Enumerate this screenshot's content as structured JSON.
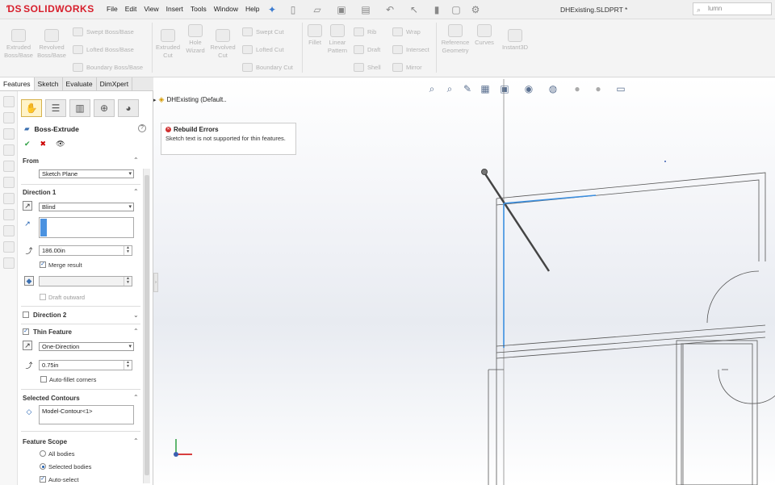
{
  "app": {
    "logo_text": "SOLIDWORKS",
    "doc_title": "DHExisting.SLDPRT *"
  },
  "menu": [
    "File",
    "Edit",
    "View",
    "Insert",
    "Tools",
    "Window",
    "Help"
  ],
  "search": {
    "value": "lumn"
  },
  "ribbon": {
    "extruded_boss": "Extruded Boss/Base",
    "revolved_boss": "Revolved Boss/Base",
    "swept_boss": "Swept Boss/Base",
    "lofted_boss": "Lofted Boss/Base",
    "boundary_boss": "Boundary Boss/Base",
    "extruded_cut": "Extruded Cut",
    "hole_wizard": "Hole Wizard",
    "revolved_cut": "Revolved Cut",
    "swept_cut": "Swept Cut",
    "lofted_cut": "Lofted Cut",
    "boundary_cut": "Boundary Cut",
    "fillet": "Fillet",
    "linear_pattern": "Linear Pattern",
    "rib": "Rib",
    "draft": "Draft",
    "shell": "Shell",
    "wrap": "Wrap",
    "intersect": "Intersect",
    "mirror": "Mirror",
    "reference_geometry": "Reference Geometry",
    "curves": "Curves",
    "instant3d": "Instant3D"
  },
  "tabs": [
    "Features",
    "Sketch",
    "Evaluate",
    "DimXpert"
  ],
  "property_manager": {
    "title": "Boss-Extrude",
    "help": "?",
    "from": {
      "header": "From",
      "selection": "Sketch Plane"
    },
    "direction1": {
      "header": "Direction 1",
      "end_condition": "Blind",
      "depth": "186.00in",
      "merge_result": "Merge result",
      "draft_outward": "Draft outward"
    },
    "direction2": {
      "header": "Direction 2"
    },
    "thin_feature": {
      "header": "Thin Feature",
      "type": "One-Direction",
      "thickness": "0.75in",
      "auto_fillet": "Auto-fillet corners"
    },
    "selected_contours": {
      "header": "Selected Contours",
      "value": "Model-Contour<1>"
    },
    "feature_scope": {
      "header": "Feature Scope",
      "all_bodies": "All bodies",
      "selected_bodies": "Selected bodies",
      "auto_select": "Auto-select"
    }
  },
  "graphics": {
    "tree_item": "DHExisting  (Default..",
    "tooltip_title": "Rebuild Errors",
    "tooltip_body": "Sketch text is not supported for thin features."
  },
  "colors": {
    "brand": "#d71e2b",
    "selection_blue": "#3b8fe0",
    "ok_green": "#2ea043",
    "cancel_red": "#cc0000"
  }
}
